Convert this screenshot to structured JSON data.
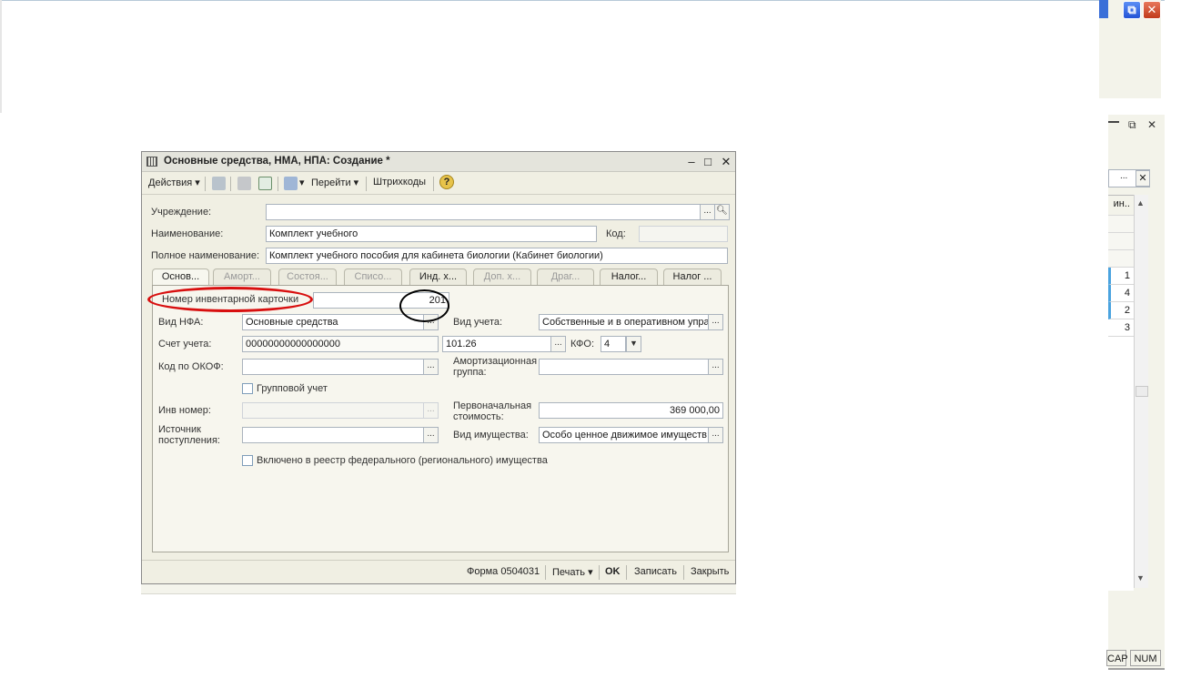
{
  "dialog": {
    "title": "Основные средства, НМА, НПА: Создание *",
    "toolbar": {
      "actions": "Действия",
      "goto": "Перейти",
      "barcodes": "Штрихкоды",
      "help": "?"
    },
    "header": {
      "institution_label": "Учреждение:",
      "institution_value": "",
      "name_label": "Наименование:",
      "name_value": "Комплект учебного",
      "code_label": "Код:",
      "code_value": "",
      "fullname_label": "Полное наименование:",
      "fullname_value": "Комплект учебного пособия для кабинета биологии (Кабинет биологии)"
    },
    "tabs": [
      "Основ...",
      "Аморт...",
      "Состоя...",
      "Списо...",
      "Инд. х...",
      "Доп. х...",
      "Драг...",
      "Налог...",
      "Налог ..."
    ],
    "main": {
      "inv_card_label": "Номер инвентарной карточки",
      "inv_card_value": "201",
      "nfa_label": "Вид НФА:",
      "nfa_value": "Основные средства",
      "account_type_label": "Вид учета:",
      "account_type_value": "Собственные и в оперативном упра",
      "account_label": "Счет учета:",
      "account_value": "00000000000000000",
      "account2_value": "101.26",
      "kfo_label": "КФО:",
      "kfo_value": "4",
      "okof_label": "Код по ОКОФ:",
      "okof_value": "",
      "amort_group_label": "Амортизационная группа:",
      "amort_group_value": "",
      "group_account_label": "Групповой учет",
      "inv_number_label": "Инв номер:",
      "inv_number_value": "",
      "initial_cost_label": "Первоначальная стоимость:",
      "initial_cost_value": "369 000,00",
      "source_label": "Источник поступления:",
      "source_value": "",
      "property_type_label": "Вид имущества:",
      "property_type_value": "Особо ценное движимое имуществ",
      "registry_label": "Включено в реестр федерального (регионального) имущества"
    },
    "footer": {
      "form": "Форма 0504031",
      "print": "Печать",
      "ok": "OK",
      "save": "Записать",
      "close": "Закрыть"
    }
  },
  "background": {
    "grid_header": "ин..",
    "grid_values": [
      "1",
      "4",
      "2",
      "3"
    ],
    "status_caps": "CAP",
    "status_num": "NUM"
  },
  "colors": {
    "annotation_red": "#d80f0f",
    "annotation_black": "#000000",
    "selection_bar": "#4aa3df"
  }
}
